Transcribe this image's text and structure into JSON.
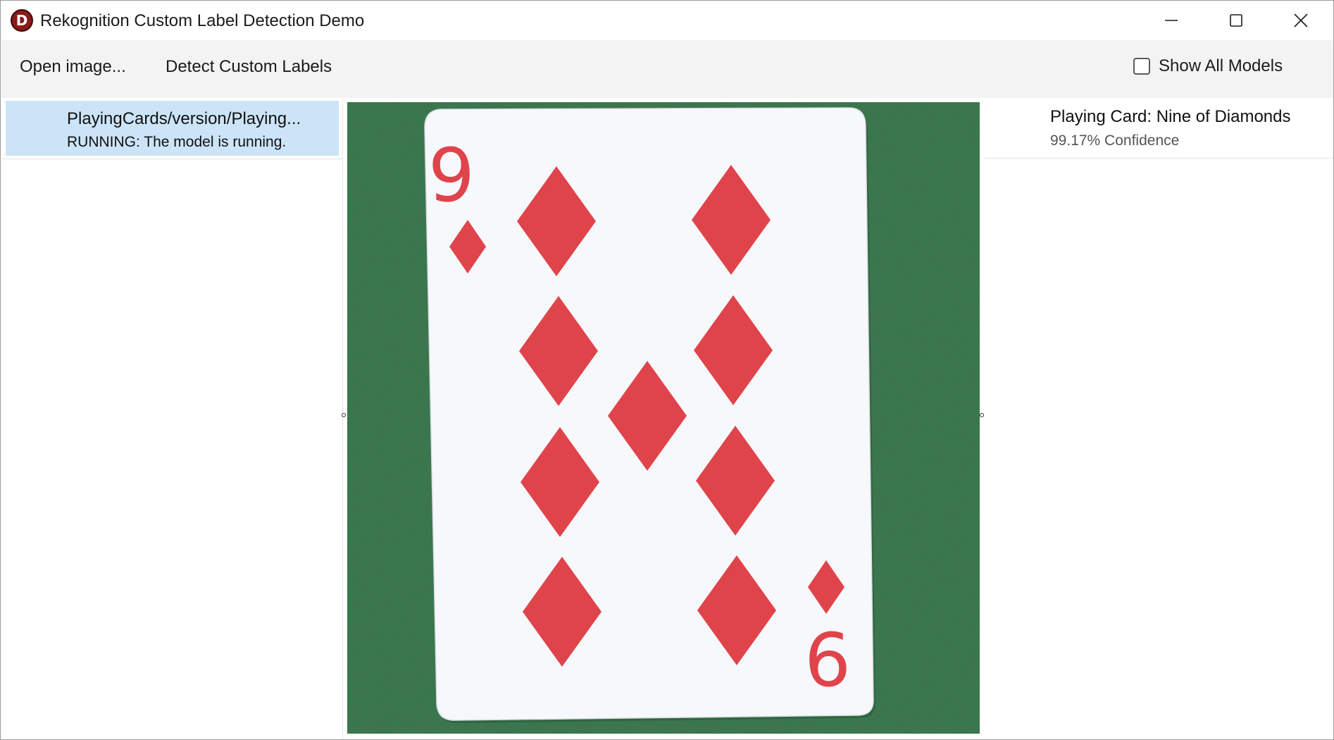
{
  "window": {
    "title": "Rekognition Custom Label Detection Demo",
    "app_icon_letter": "D",
    "controls": [
      "minimize-icon",
      "maximize-icon",
      "close-icon"
    ]
  },
  "toolbar": {
    "open_label": "Open image...",
    "detect_label": "Detect Custom Labels",
    "show_all_label": "Show All Models",
    "show_all_checked": false
  },
  "models": [
    {
      "name": "PlayingCards/version/Playing...",
      "status": "RUNNING: The model is running.",
      "selected": true
    }
  ],
  "image": {
    "subject": "playing-card-nine-of-diamonds",
    "background_color": "#2f6a3f",
    "card_color": "#f7f8fb",
    "pip_color": "#e0444b",
    "corner_rank": "9",
    "corner_rank_inverted": "9"
  },
  "results": [
    {
      "label": "Playing Card: Nine of Diamonds",
      "confidence": "99.17% Confidence"
    }
  ]
}
